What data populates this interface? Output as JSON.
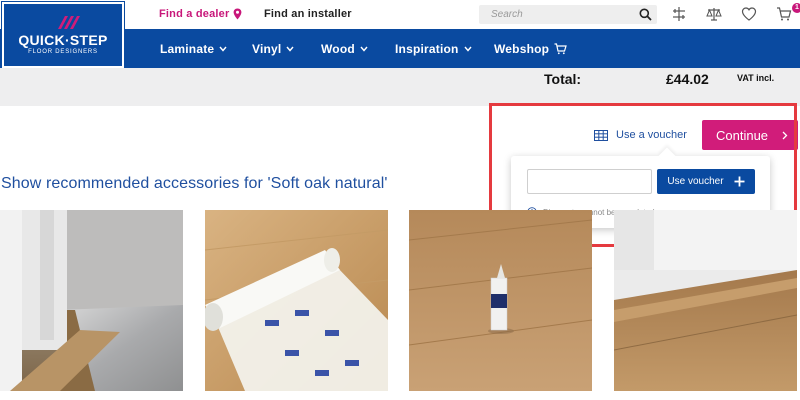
{
  "brand": {
    "name": "QUICK·STEP",
    "tagline": "FLOOR DESIGNERS"
  },
  "topbar": {
    "find_dealer": "Find a dealer",
    "find_installer": "Find an installer",
    "search_placeholder": "Search",
    "cart_count": "1",
    "icons": [
      "search-icon",
      "compare-icon",
      "scale-icon",
      "heart-icon",
      "cart-icon"
    ]
  },
  "nav": {
    "items": [
      {
        "label": "Laminate"
      },
      {
        "label": "Vinyl"
      },
      {
        "label": "Wood"
      },
      {
        "label": "Inspiration"
      },
      {
        "label": "Webshop"
      }
    ]
  },
  "summary": {
    "total_label": "Total:",
    "total_value": "£44.02",
    "vat_label": "VAT incl."
  },
  "voucher": {
    "link_label": "Use a voucher",
    "input_value": "",
    "button_label": "Use voucher",
    "note": "Discounts cannot be cumulated."
  },
  "checkout": {
    "continue_label": "Continue"
  },
  "recommended": {
    "title": "Show recommended accessories for 'Soft oak natural'",
    "products": [
      {
        "name": "profile-transition"
      },
      {
        "name": "underlay-roll"
      },
      {
        "name": "sealant-tube"
      },
      {
        "name": "skirting-board"
      }
    ]
  },
  "colors": {
    "brand_blue": "#0a4aa0",
    "accent_pink": "#d11c7a",
    "highlight_red": "#e53a3f"
  }
}
